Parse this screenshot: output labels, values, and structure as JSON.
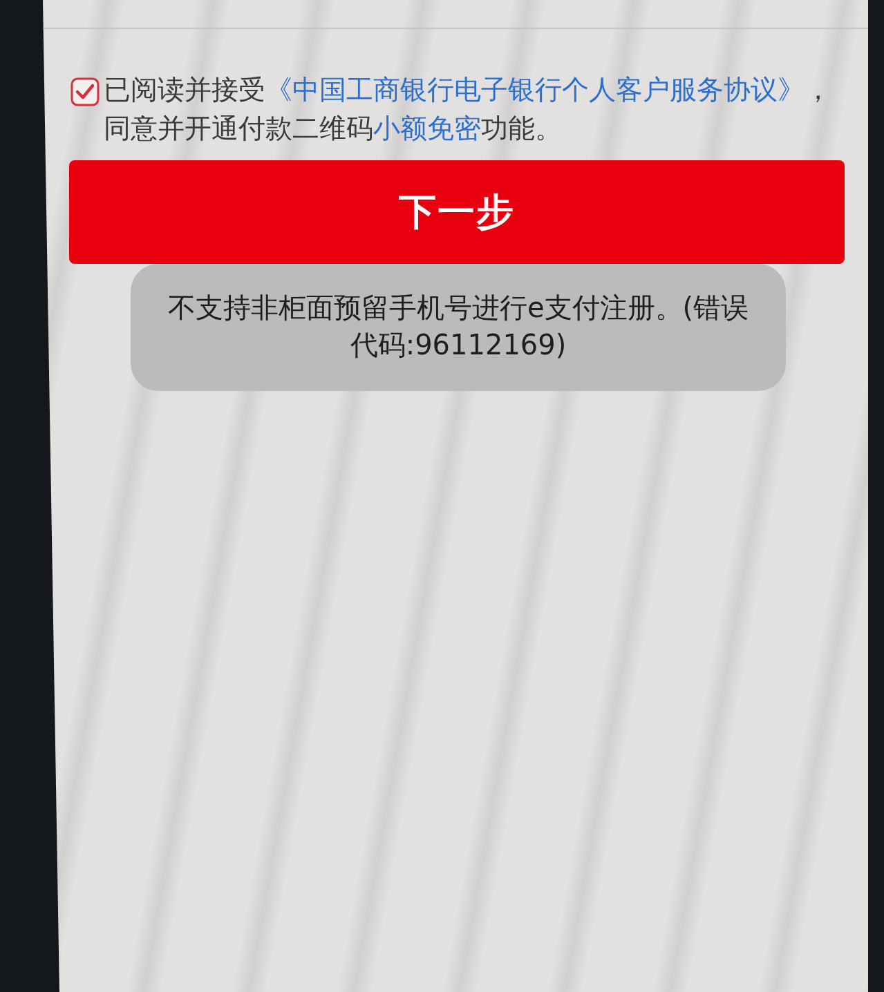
{
  "agreement": {
    "checked": true,
    "parts": [
      {
        "kind": "text",
        "text": "已阅读并接受"
      },
      {
        "kind": "link",
        "text": "《中国工商银行电子银行个人客户服务协议》"
      },
      {
        "kind": "text",
        "text": "，同意并开通付款二维码"
      },
      {
        "kind": "link",
        "text": "小额免密"
      },
      {
        "kind": "text",
        "text": "功能。"
      }
    ]
  },
  "next_button": {
    "label": "下一步"
  },
  "toast": {
    "message": "不支持非柜面预留手机号进行e支付注册。(错误代码:96112169)"
  }
}
